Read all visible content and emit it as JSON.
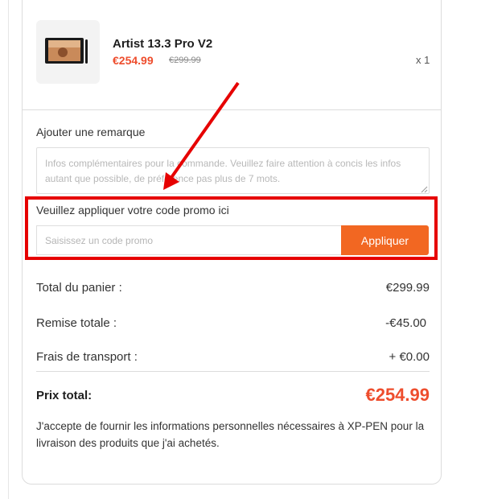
{
  "product": {
    "name": "Artist 13.3 Pro V2",
    "price_now": "€254.99",
    "price_old": "€299.99",
    "quantity": "x 1",
    "thumbnail_icon": "drawing-tablet-image"
  },
  "remark": {
    "label": "Ajouter une remarque",
    "placeholder": "Infos complémentaires pour la commande. Veuillez faire attention à concis les infos autant que possible, de préférence pas plus de 7 mots."
  },
  "promo": {
    "label": "Veuillez appliquer votre code promo ici",
    "placeholder": "Saisissez un code promo",
    "button_label": "Appliquer"
  },
  "summary": {
    "rows": [
      {
        "label": "Total du panier :",
        "value": "€299.99"
      },
      {
        "label": "Remise totale :",
        "value": "-€45.00"
      },
      {
        "label": "Frais de transport :",
        "value": "+ €0.00"
      }
    ],
    "total_label": "Prix total:",
    "total_value": "€254.99"
  },
  "consent_text": "J'accepte de fournir les informations personnelles nécessaires à XP-PEN pour la livraison des produits que j'ai achetés.",
  "colors": {
    "accent": "#ee4d2d",
    "button": "#f26722",
    "highlight": "#e60000"
  }
}
